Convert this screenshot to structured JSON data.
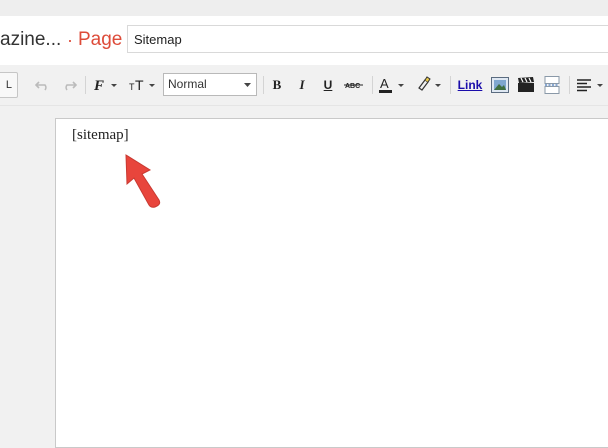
{
  "header": {
    "blog_title": "azine...",
    "separator": "·",
    "page_label": "Page",
    "title_value": "Sitemap"
  },
  "toolbar": {
    "mode_label": "L",
    "font_size_value": "Normal",
    "link_label": "Link",
    "icons": [
      "undo-icon",
      "redo-icon",
      "font-family-icon",
      "font-size-icon",
      "bold-icon",
      "italic-icon",
      "underline-icon",
      "strikethrough-icon",
      "text-color-icon",
      "highlight-color-icon",
      "image-icon",
      "video-icon",
      "jump-break-icon",
      "align-icon"
    ]
  },
  "editor": {
    "content": "[sitemap]"
  },
  "annotation": {
    "arrow_color": "#e8453c"
  },
  "colors": {
    "accent": "#dd4b39",
    "link": "#1a0dab",
    "background": "#f1f1f1"
  }
}
